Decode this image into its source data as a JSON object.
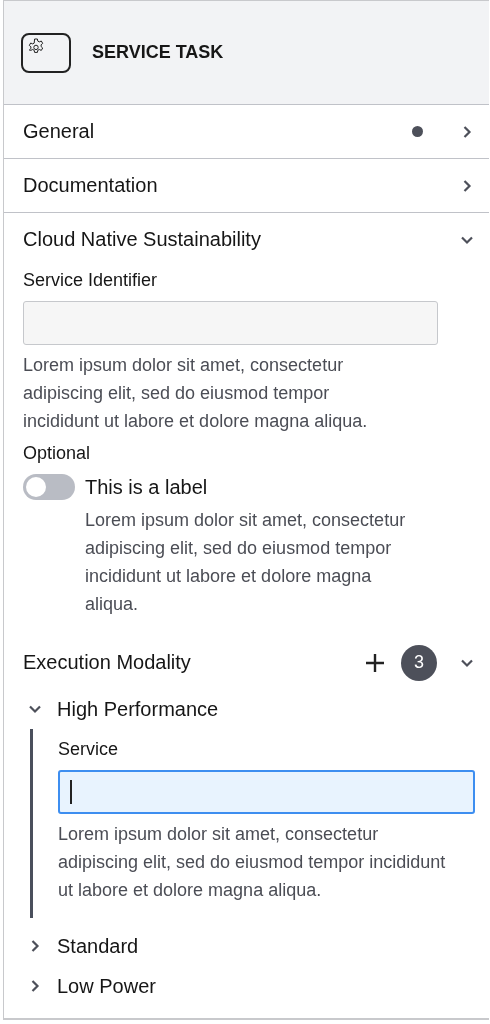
{
  "header": {
    "title": "SERVICE TASK"
  },
  "groups": [
    {
      "kind": "plain",
      "title": "General",
      "expanded": false,
      "edited": true
    },
    {
      "kind": "plain",
      "title": "Documentation",
      "expanded": false,
      "edited": false
    },
    {
      "kind": "plain",
      "title": "Cloud Native Sustainability",
      "expanded": true,
      "edited": false,
      "entries": [
        {
          "kind": "textfield",
          "label": "Service Identifier",
          "focused": false,
          "description": "Lorem ipsum dolor sit amet, consectetur adipiscing elit, sed do eiusmod tempor incididunt ut labore et dolore magna aliqua."
        },
        {
          "kind": "toggle",
          "label": "Optional",
          "switch_label": "This is a label",
          "on": false,
          "description": "Lorem ipsum dolor sit amet, consectetur adipiscing elit, sed do eiusmod tempor incididunt ut labore et dolore magna aliqua."
        }
      ]
    },
    {
      "kind": "list",
      "title": "Execution Modality",
      "expanded": true,
      "edited": false,
      "count": "3",
      "items": [
        {
          "title": "High Performance",
          "expanded": true,
          "entries": [
            {
              "kind": "textfield",
              "label": "Service",
              "focused": true,
              "description": "Lorem ipsum dolor sit amet, consectetur adipiscing elit, sed do eiusmod tempor incididunt ut labore et dolore magna aliqua."
            }
          ]
        },
        {
          "title": "Standard",
          "expanded": false
        },
        {
          "title": "Low Power",
          "expanded": false
        }
      ]
    }
  ]
}
